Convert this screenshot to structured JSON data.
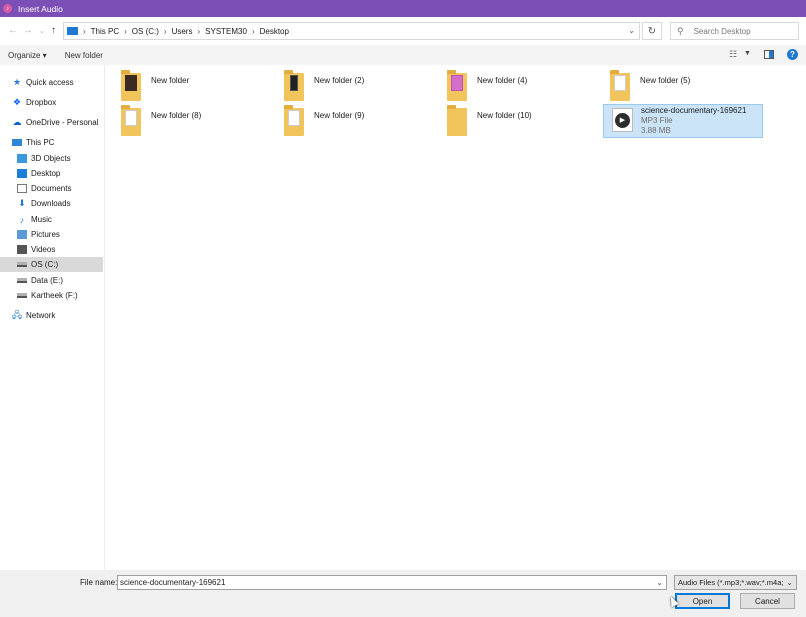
{
  "window": {
    "title": "Insert Audio",
    "accent": "#7b4fb5"
  },
  "address": {
    "crumbs": [
      "This PC",
      "OS (C:)",
      "Users",
      "SYSTEM30",
      "Desktop"
    ],
    "search_placeholder": "Search Desktop"
  },
  "toolbar": {
    "organize": "Organize ▾",
    "new_folder": "New folder"
  },
  "nav": {
    "items": [
      {
        "label": "Quick access",
        "icon": "star-icon"
      },
      {
        "label": "Dropbox",
        "icon": "dropbox-icon"
      },
      {
        "label": "OneDrive - Personal",
        "icon": "cloud-icon"
      },
      {
        "label": "This PC",
        "icon": "pc-icon"
      },
      {
        "label": "3D Objects",
        "icon": "3d-objects-icon"
      },
      {
        "label": "Desktop",
        "icon": "desktop-icon"
      },
      {
        "label": "Documents",
        "icon": "documents-icon"
      },
      {
        "label": "Downloads",
        "icon": "downloads-icon"
      },
      {
        "label": "Music",
        "icon": "music-icon"
      },
      {
        "label": "Pictures",
        "icon": "pictures-icon"
      },
      {
        "label": "Videos",
        "icon": "videos-icon"
      },
      {
        "label": "OS (C:)",
        "icon": "drive-icon"
      },
      {
        "label": "Data (E:)",
        "icon": "drive-icon"
      },
      {
        "label": "Kartheek  (F:)",
        "icon": "drive-icon"
      },
      {
        "label": "Network",
        "icon": "network-icon"
      }
    ],
    "selected": "OS (C:)"
  },
  "files": [
    {
      "name": "New folder",
      "type": "folder"
    },
    {
      "name": "New folder (2)",
      "type": "folder"
    },
    {
      "name": "New folder (4)",
      "type": "folder"
    },
    {
      "name": "New folder (5)",
      "type": "folder"
    },
    {
      "name": "New folder (8)",
      "type": "folder"
    },
    {
      "name": "New folder (9)",
      "type": "folder"
    },
    {
      "name": "New folder (10)",
      "type": "folder"
    },
    {
      "name": "science-documentary-169621",
      "type": "MP3 File",
      "size": "3.88 MB",
      "selected": true
    }
  ],
  "footer": {
    "file_name_label": "File name:",
    "file_name_value": "science-documentary-169621",
    "filter": "Audio Files (*.mp3;*.wav;*.m4a;",
    "open": "Open",
    "cancel": "Cancel"
  }
}
